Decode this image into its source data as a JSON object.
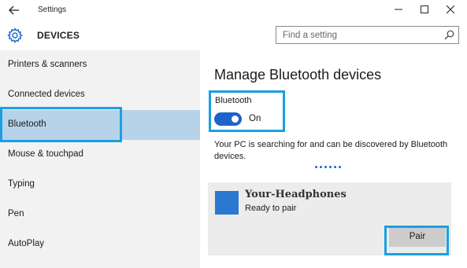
{
  "window": {
    "title": "Settings",
    "controls": {
      "back_icon": "back-arrow-icon",
      "minimize_icon": "minimize-icon",
      "maximize_icon": "maximize-icon",
      "close_icon": "close-icon"
    }
  },
  "header": {
    "icon": "gear-icon",
    "title": "DEVICES",
    "search": {
      "placeholder": "Find a setting",
      "value": "",
      "icon": "search-icon"
    }
  },
  "sidebar": {
    "items": [
      {
        "label": "Printers & scanners",
        "selected": false
      },
      {
        "label": "Connected devices",
        "selected": false
      },
      {
        "label": "Bluetooth",
        "selected": true
      },
      {
        "label": "Mouse & touchpad",
        "selected": false
      },
      {
        "label": "Typing",
        "selected": false
      },
      {
        "label": "Pen",
        "selected": false
      },
      {
        "label": "AutoPlay",
        "selected": false
      }
    ]
  },
  "main": {
    "title": "Manage Bluetooth devices",
    "bluetooth_toggle": {
      "label": "Bluetooth",
      "state_text": "On",
      "on": true
    },
    "status_text": "Your PC is searching for and can be discovered by Bluetooth devices.",
    "device": {
      "name": "Your-Headphones",
      "status": "Ready to pair",
      "action_label": "Pair"
    }
  },
  "colors": {
    "accent": "#1e64c8",
    "selected_bg": "#b7d3ea",
    "highlight": "#1aa0e0",
    "sidebar_bg": "#f2f2f2",
    "card_bg": "#ececec",
    "device_thumb": "#2a78cf"
  }
}
